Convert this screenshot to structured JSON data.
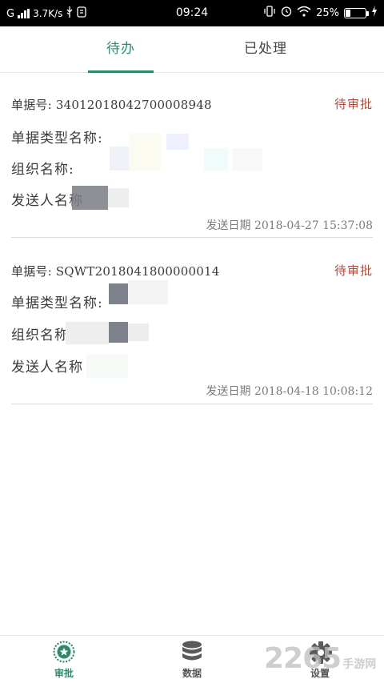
{
  "statusbar": {
    "carrier": "G",
    "speed": "3.7K/s",
    "time": "09:24",
    "battery": "25%",
    "battery_level": 0.25
  },
  "tabs": [
    {
      "label": "待办",
      "active": true
    },
    {
      "label": "已处理",
      "active": false
    }
  ],
  "labels": {
    "doc_no": "单据号: ",
    "doc_type": "单据类型名称:",
    "org": "组织名称:",
    "sender": "发送人名称",
    "send_date": "发送日期"
  },
  "cards": [
    {
      "doc_no": "340120180427000089​48",
      "status": "待审批",
      "date": "2018-04-27 15:37:08"
    },
    {
      "doc_no": "SQWT2018041800000014",
      "status": "待审批",
      "date": "2018-04-18 10:08:12"
    }
  ],
  "bottomnav": [
    {
      "label": "审批",
      "icon": "approve-icon",
      "active": true
    },
    {
      "label": "数据",
      "icon": "database-icon",
      "active": false
    },
    {
      "label": "设置",
      "icon": "gear-icon",
      "active": false
    }
  ],
  "watermark": {
    "text": "2265",
    "suffix": "手游网"
  },
  "colors": {
    "accent": "#2f8a6c",
    "status": "#b14a3a"
  }
}
